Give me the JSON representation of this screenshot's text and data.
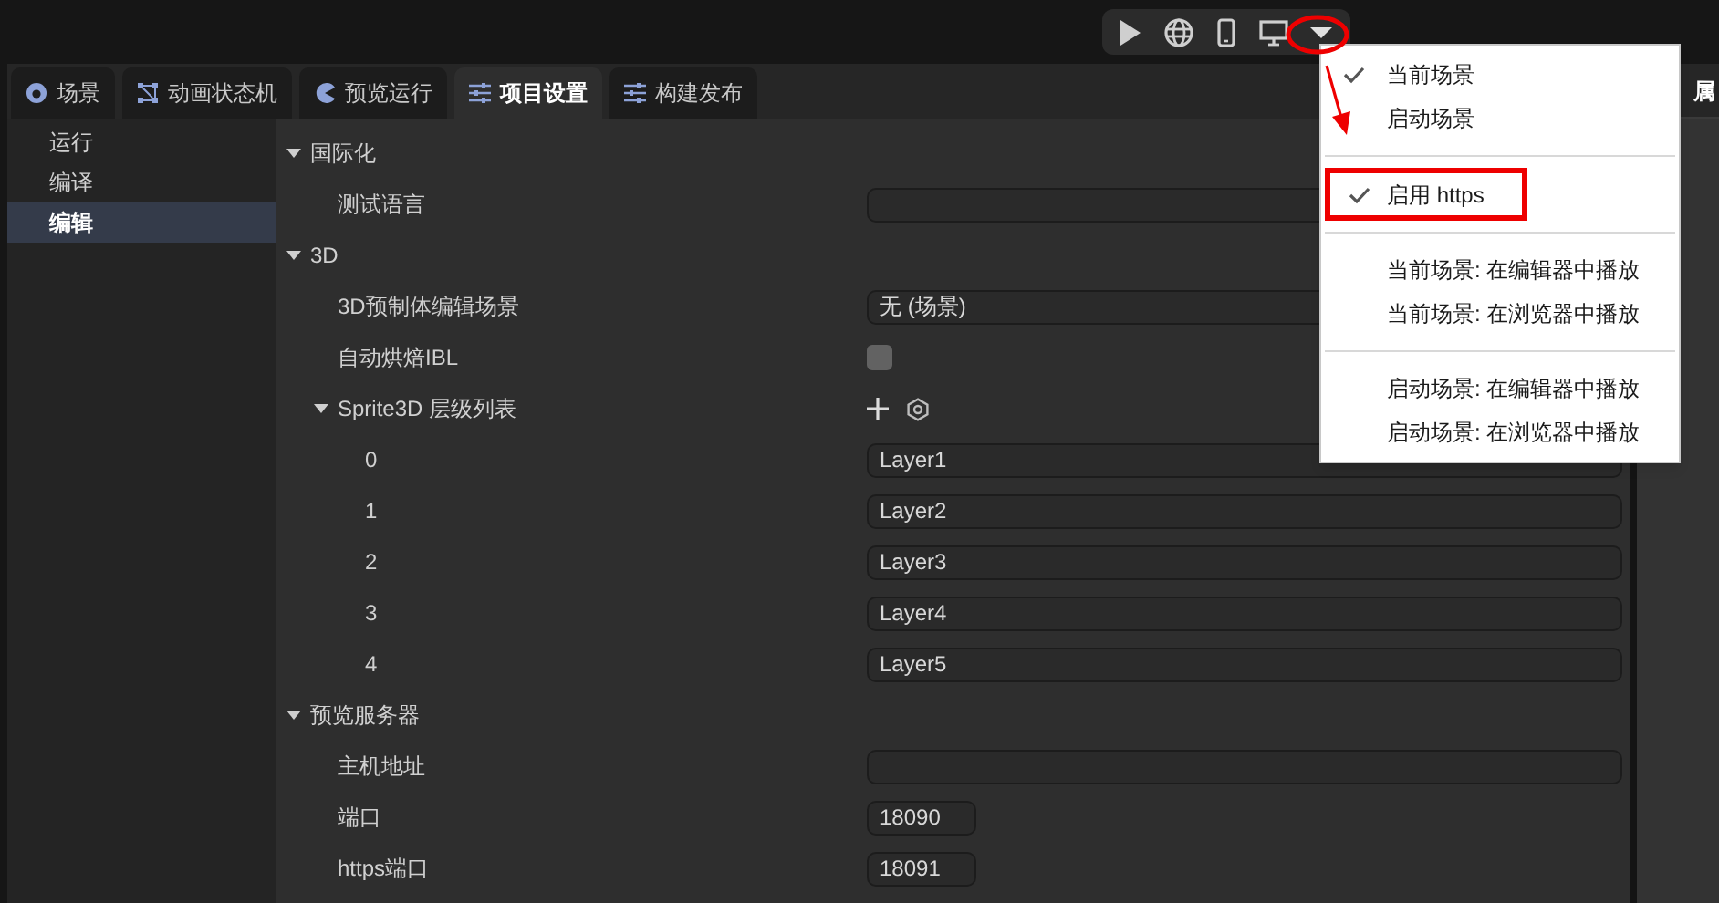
{
  "toolbar": {
    "buttons": [
      {
        "kind": "play"
      },
      {
        "kind": "globe"
      },
      {
        "kind": "phone"
      },
      {
        "kind": "monitor"
      },
      {
        "kind": "caret"
      }
    ]
  },
  "tabs": [
    {
      "label": "场景",
      "kind": "scene",
      "selected": false
    },
    {
      "label": "动画状态机",
      "kind": "graph",
      "selected": false
    },
    {
      "label": "预览运行",
      "kind": "preview",
      "selected": false
    },
    {
      "label": "项目设置",
      "kind": "settings",
      "selected": true
    },
    {
      "label": "构建发布",
      "kind": "settings",
      "selected": false
    }
  ],
  "sidebar": {
    "items": [
      {
        "label": "运行",
        "selected": false
      },
      {
        "label": "编译",
        "selected": false
      },
      {
        "label": "编辑",
        "selected": true
      }
    ]
  },
  "sections": [
    {
      "title": "国际化",
      "expanded": true,
      "rows": [
        {
          "label": "测试语言",
          "kind": "text",
          "value": ""
        }
      ]
    },
    {
      "title": "3D",
      "expanded": true,
      "rows": [
        {
          "label": "3D预制体编辑场景",
          "kind": "select",
          "value": "无 (场景)"
        },
        {
          "label": "自动烘焙IBL",
          "kind": "checkbox",
          "checked": false
        },
        {
          "label": "Sprite3D 层级列表",
          "kind": "list",
          "expanded": true,
          "children": [
            {
              "label": "0",
              "kind": "text",
              "value": "Layer1"
            },
            {
              "label": "1",
              "kind": "text",
              "value": "Layer2"
            },
            {
              "label": "2",
              "kind": "text",
              "value": "Layer3"
            },
            {
              "label": "3",
              "kind": "text",
              "value": "Layer4"
            },
            {
              "label": "4",
              "kind": "text",
              "value": "Layer5"
            }
          ]
        }
      ]
    },
    {
      "title": "预览服务器",
      "expanded": true,
      "rows": [
        {
          "label": "主机地址",
          "kind": "text",
          "value": ""
        },
        {
          "label": "端口",
          "kind": "short",
          "value": "18090"
        },
        {
          "label": "https端口",
          "kind": "short",
          "value": "18091"
        }
      ]
    }
  ],
  "right_panel": {
    "title": "属"
  },
  "menu": {
    "groups": [
      [
        {
          "label": "当前场景",
          "checked": true
        },
        {
          "label": "启动场景",
          "checked": false
        }
      ],
      [
        {
          "label": "启用 https",
          "checked": true,
          "highlighted": true
        }
      ],
      [
        {
          "label": "当前场景: 在编辑器中播放",
          "checked": false
        },
        {
          "label": "当前场景: 在浏览器中播放",
          "checked": false
        }
      ],
      [
        {
          "label": "启动场景: 在编辑器中播放",
          "checked": false
        },
        {
          "label": "启动场景: 在浏览器中播放",
          "checked": false
        }
      ]
    ]
  }
}
